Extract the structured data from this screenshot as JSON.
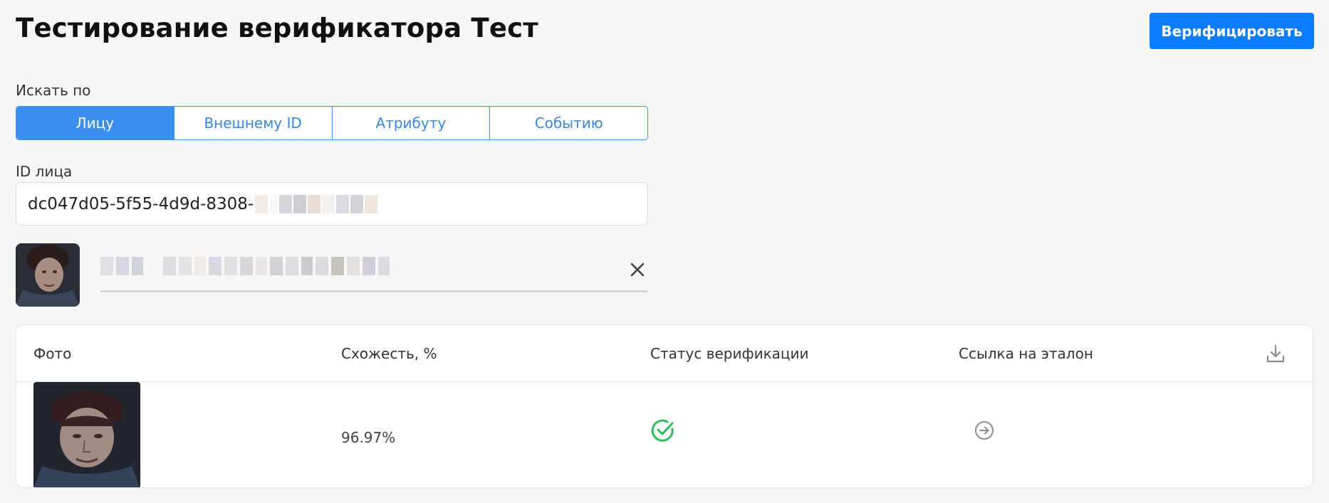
{
  "page": {
    "title": "Тестирование верификатора Тест",
    "verify_button": "Верифицировать"
  },
  "search": {
    "label": "Искать по",
    "tabs": [
      {
        "label": "Лицу",
        "active": true
      },
      {
        "label": "Внешнему ID",
        "active": false
      },
      {
        "label": "Атрибуту",
        "active": false
      },
      {
        "label": "Событию",
        "active": false
      }
    ]
  },
  "face_id": {
    "label": "ID лица",
    "value": "dc047d05-5f55-4d9d-8308-"
  },
  "selected_face": {
    "thumbnail": "face-photo",
    "clear_icon": "close-icon"
  },
  "results": {
    "columns": {
      "photo": "Фото",
      "similarity": "Схожесть, %",
      "status": "Статус верификации",
      "reference_link": "Ссылка на эталон"
    },
    "download_icon": "download-icon",
    "rows": [
      {
        "photo": "face-photo",
        "similarity": "96.97%",
        "status_icon": "check-circle-icon",
        "link_icon": "arrow-right-circle-icon"
      }
    ]
  },
  "colors": {
    "accent": "#0a7cff",
    "success": "#2ebd59",
    "background": "#f7f7f7"
  }
}
